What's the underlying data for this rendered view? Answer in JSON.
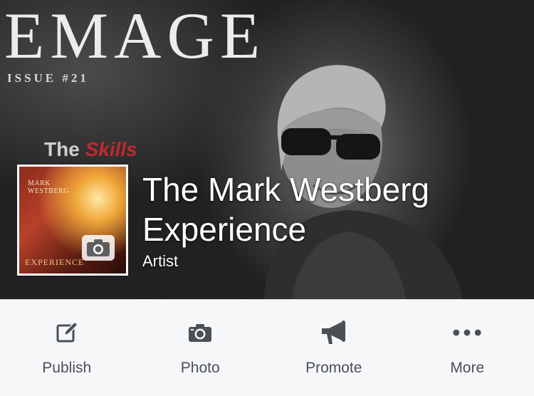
{
  "cover": {
    "magazine_title": "EMAGE",
    "issue": "ISSUE #21",
    "teaser_word1": "The",
    "teaser_word2": "Skills"
  },
  "profile_picture": {
    "line1": "MARK",
    "line2": "WESTBERG",
    "bottom_text": "EXPERIENCE"
  },
  "page": {
    "name": "The Mark Westberg Experience",
    "category": "Artist"
  },
  "actions": [
    {
      "label": "Publish",
      "icon": "edit-icon"
    },
    {
      "label": "Photo",
      "icon": "camera-icon"
    },
    {
      "label": "Promote",
      "icon": "megaphone-icon"
    },
    {
      "label": "More",
      "icon": "more-icon"
    }
  ],
  "colors": {
    "icon": "#4b4f56",
    "label": "#4b4f56",
    "action_bar_bg": "#f6f7f9"
  }
}
